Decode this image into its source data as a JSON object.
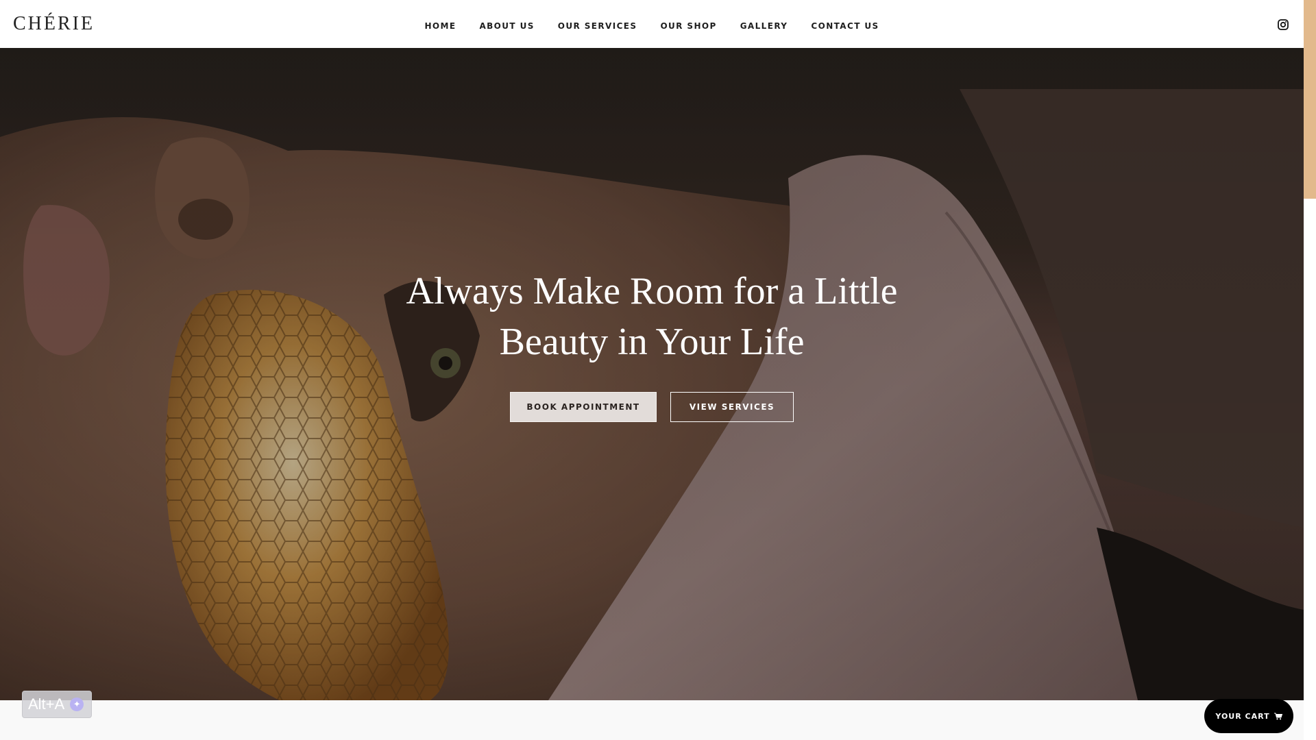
{
  "brand": {
    "logo_text": "CHÉRIE"
  },
  "nav": {
    "items": [
      {
        "label": "HOME"
      },
      {
        "label": "ABOUT US"
      },
      {
        "label": "OUR SERVICES"
      },
      {
        "label": "OUR SHOP"
      },
      {
        "label": "GALLERY"
      },
      {
        "label": "CONTACT US"
      }
    ],
    "social_icon": "instagram-icon"
  },
  "hero": {
    "headline": "Always Make Room for a Little Beauty in Your Life",
    "primary_button": "BOOK APPOINTMENT",
    "secondary_button": "VIEW SERVICES"
  },
  "accessibility_badge": {
    "label": "Alt+A"
  },
  "cart": {
    "label": "YOUR CART",
    "icon": "cart-icon"
  },
  "colors": {
    "scroll_thumb": "#e2b98c",
    "book_button_bg": "#e2dcd9",
    "cart_bg": "#000000"
  }
}
